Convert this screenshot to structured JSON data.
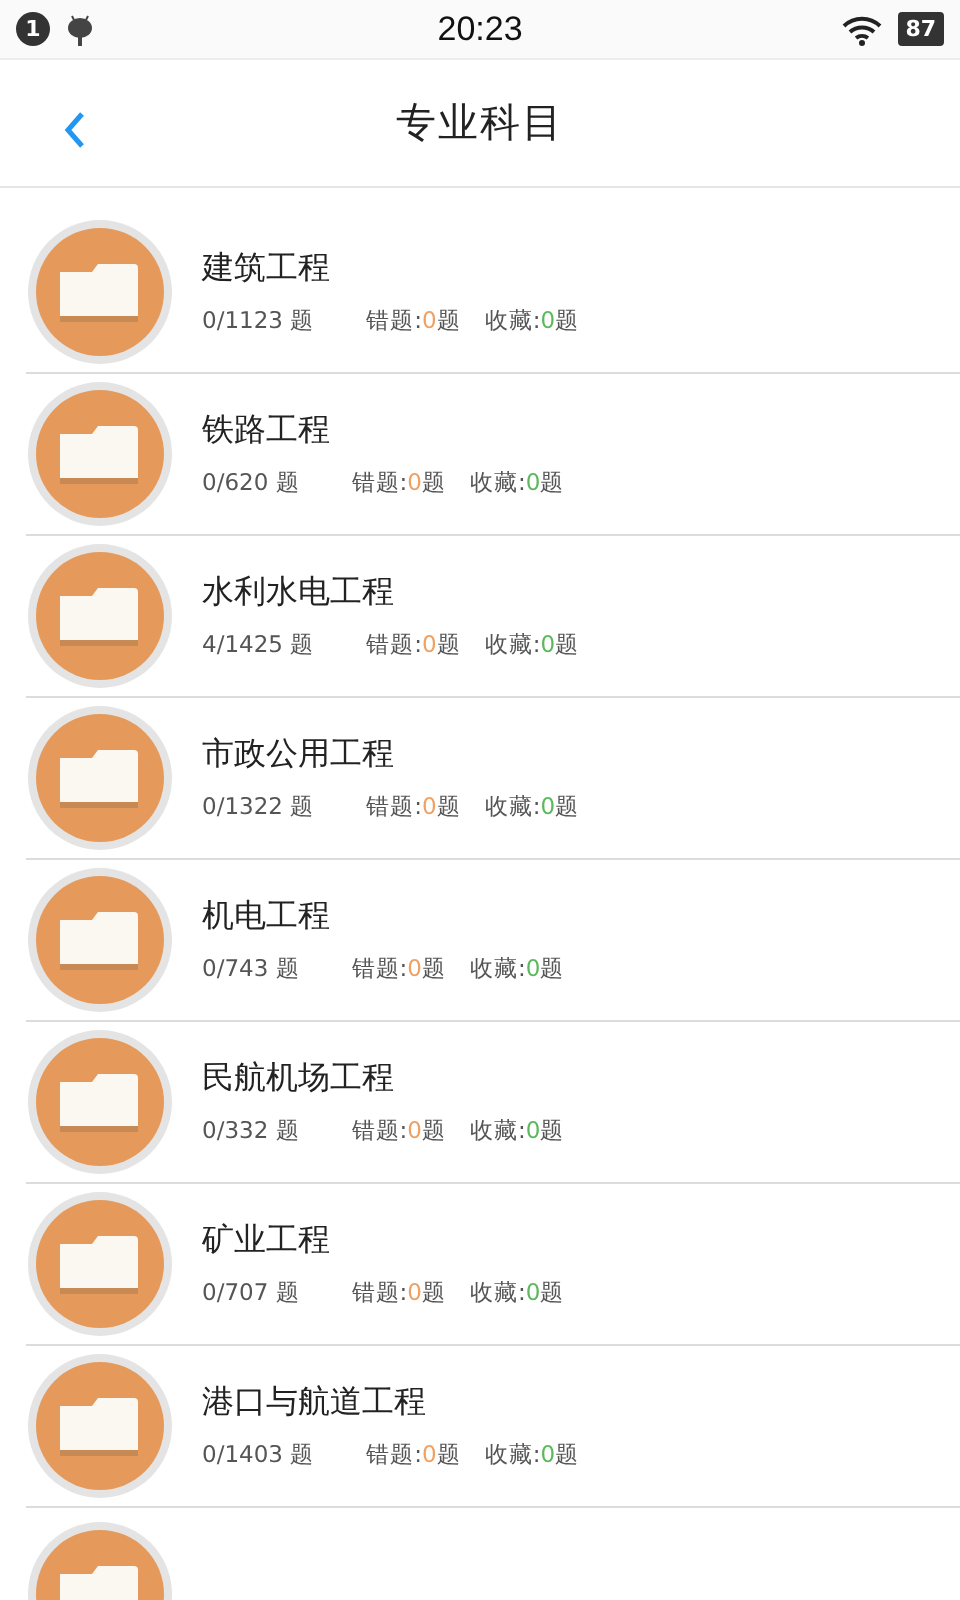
{
  "status_bar": {
    "notification_count": "1",
    "time": "20:23",
    "battery": "87"
  },
  "nav": {
    "title": "专业科目"
  },
  "subjects": [
    {
      "title": "建筑工程",
      "progress": "0/1123 题",
      "wrong": {
        "label": "错题:",
        "count": "0",
        "unit": "题"
      },
      "favorites": {
        "label": "收藏:",
        "count": "0",
        "unit": "题"
      }
    },
    {
      "title": "铁路工程",
      "progress": "0/620 题",
      "wrong": {
        "label": "错题:",
        "count": "0",
        "unit": "题"
      },
      "favorites": {
        "label": "收藏:",
        "count": "0",
        "unit": "题"
      }
    },
    {
      "title": "水利水电工程",
      "progress": "4/1425 题",
      "wrong": {
        "label": "错题:",
        "count": "0",
        "unit": "题"
      },
      "favorites": {
        "label": "收藏:",
        "count": "0",
        "unit": "题"
      }
    },
    {
      "title": "市政公用工程",
      "progress": "0/1322 题",
      "wrong": {
        "label": "错题:",
        "count": "0",
        "unit": "题"
      },
      "favorites": {
        "label": "收藏:",
        "count": "0",
        "unit": "题"
      }
    },
    {
      "title": "机电工程",
      "progress": "0/743 题",
      "wrong": {
        "label": "错题:",
        "count": "0",
        "unit": "题"
      },
      "favorites": {
        "label": "收藏:",
        "count": "0",
        "unit": "题"
      }
    },
    {
      "title": "民航机场工程",
      "progress": "0/332 题",
      "wrong": {
        "label": "错题:",
        "count": "0",
        "unit": "题"
      },
      "favorites": {
        "label": "收藏:",
        "count": "0",
        "unit": "题"
      }
    },
    {
      "title": "矿业工程",
      "progress": "0/707 题",
      "wrong": {
        "label": "错题:",
        "count": "0",
        "unit": "题"
      },
      "favorites": {
        "label": "收藏:",
        "count": "0",
        "unit": "题"
      }
    },
    {
      "title": "港口与航道工程",
      "progress": "0/1403 题",
      "wrong": {
        "label": "错题:",
        "count": "0",
        "unit": "题"
      },
      "favorites": {
        "label": "收藏:",
        "count": "0",
        "unit": "题"
      }
    }
  ],
  "partial_row_below": true
}
